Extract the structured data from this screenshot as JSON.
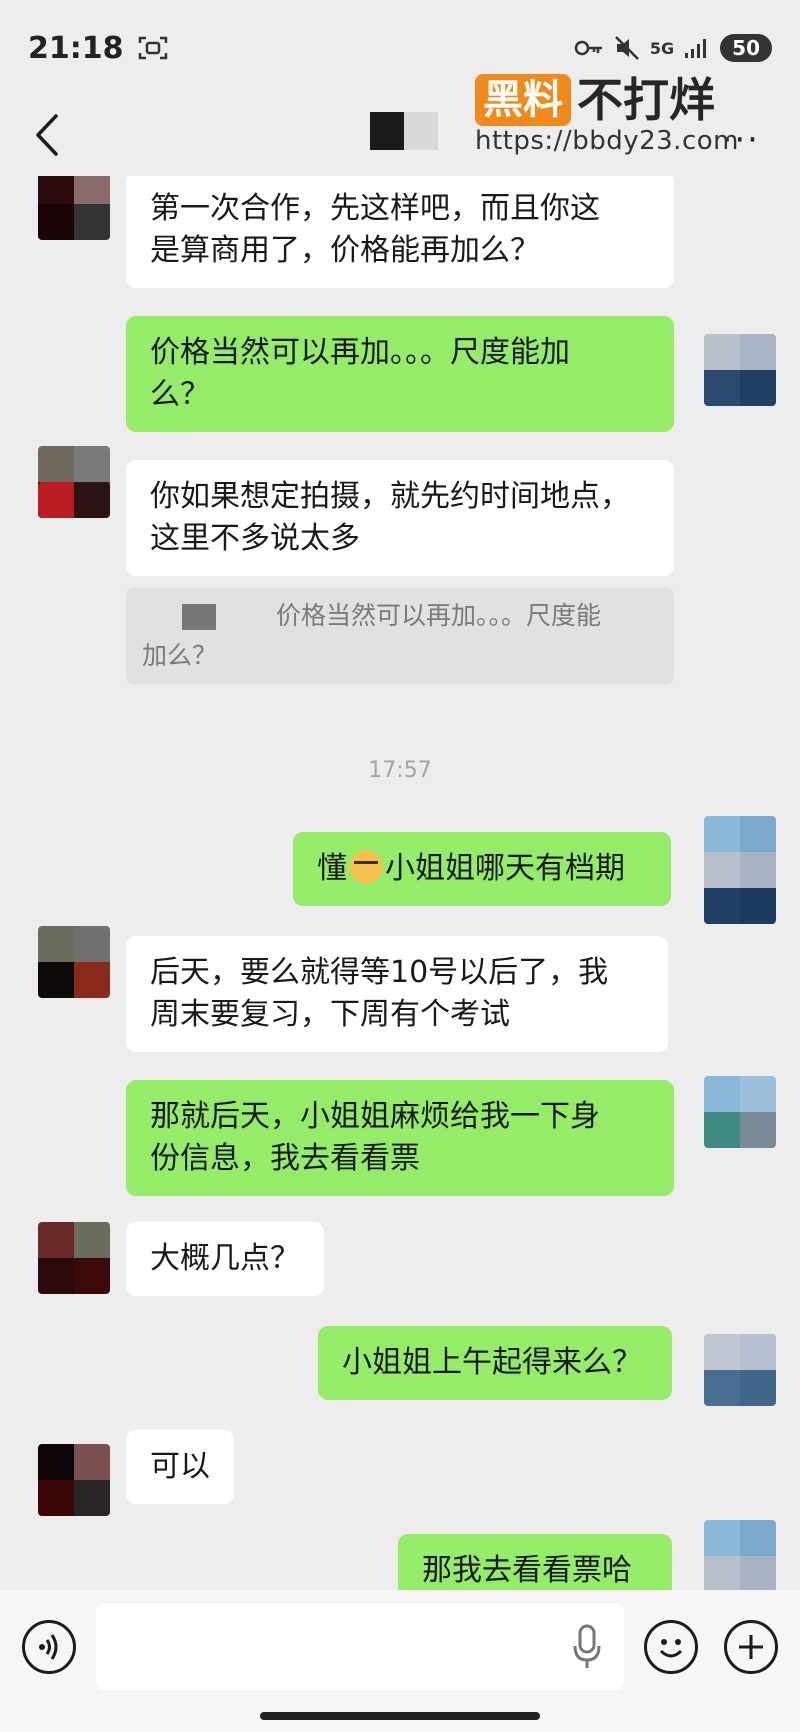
{
  "status_bar": {
    "time": "21:18",
    "network": "5G",
    "battery": "50"
  },
  "watermark": {
    "badge": "黑料",
    "title": "不打烊",
    "url": "https://bbdy23.com"
  },
  "nav": {
    "more": "···"
  },
  "messages": [
    {
      "side": "in",
      "text_lines": [
        "第一次合作，先这样吧，而且你这",
        "是算商用了，价格能再加么？"
      ]
    },
    {
      "side": "out",
      "text_lines": [
        "价格当然可以再加。。。尺度能加",
        "么？"
      ]
    },
    {
      "side": "in",
      "text_lines": [
        "你如果想定拍摄，就先约时间地点，",
        "这里不多说太多"
      ]
    },
    {
      "side": "quote",
      "text_lines": [
        "价格当然可以再加。。。尺度能",
        "加么？"
      ]
    },
    {
      "side": "time",
      "text": "17:57"
    },
    {
      "side": "out",
      "text_pre": "懂",
      "text_post": "小姐姐哪天有档期"
    },
    {
      "side": "in",
      "text_lines": [
        "后天，要么就得等10号以后了，我",
        "周末要复习，下周有个考试"
      ]
    },
    {
      "side": "out",
      "text_lines": [
        "那就后天，小姐姐麻烦给我一下身",
        "份信息，我去看看票"
      ]
    },
    {
      "side": "in",
      "text_lines": [
        "大概几点？"
      ]
    },
    {
      "side": "out",
      "text_lines": [
        "小姐姐上午起得来么？"
      ]
    },
    {
      "side": "in",
      "text_lines": [
        "可以"
      ]
    },
    {
      "side": "out",
      "text_lines": [
        "那我去看看票哈"
      ]
    }
  ],
  "icons": [
    "back-icon",
    "more-icon",
    "voice-icon",
    "microphone-icon",
    "emoji-icon",
    "plus-icon"
  ]
}
